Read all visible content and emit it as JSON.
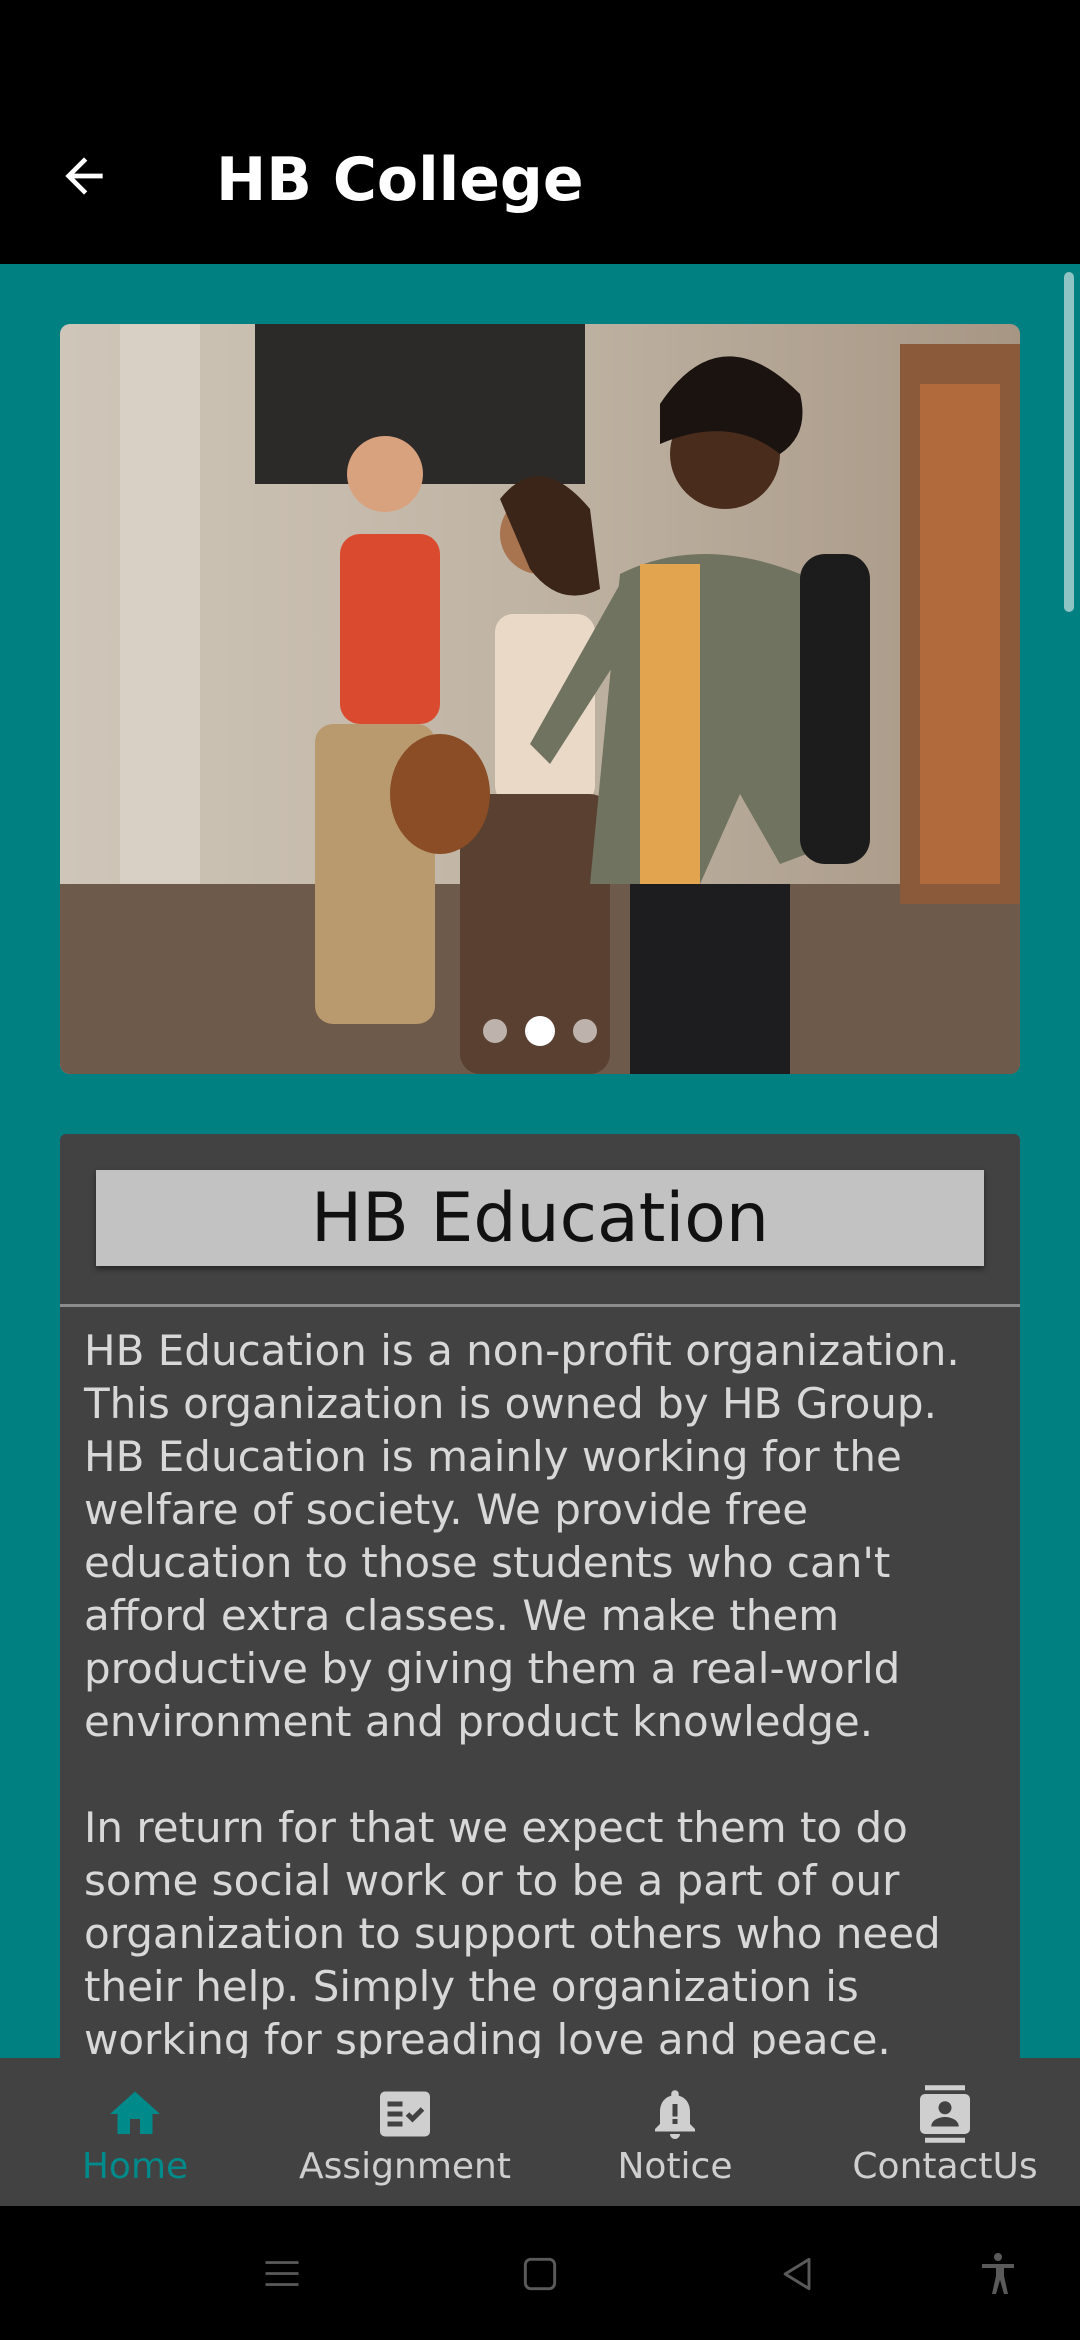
{
  "app_bar": {
    "title": "HB College",
    "back_icon": "arrow-back-icon"
  },
  "carousel": {
    "image_alt": "Three students walking together",
    "slide_count": 3,
    "active_slide": 1
  },
  "info_card": {
    "heading": "HB Education",
    "paragraphs": [
      "HB Education is a non-profit organization. This organization is owned by HB Group. HB Education is mainly working for the welfare of society. We provide free education to those students who can't afford extra classes. We make them productive by giving them a real-world environment and product knowledge.",
      "In return for that we expect them to do some social work or to be a part of our organization to support others who need their help. Simply the organization is working for spreading love and peace."
    ]
  },
  "bottom_nav": {
    "items": [
      {
        "label": "Home",
        "icon": "home-icon",
        "active": true
      },
      {
        "label": "Assignment",
        "icon": "assignment-check-icon",
        "active": false
      },
      {
        "label": "Notice",
        "icon": "bell-alert-icon",
        "active": false
      },
      {
        "label": "ContactUs",
        "icon": "contact-card-icon",
        "active": false
      }
    ]
  },
  "system_nav": {
    "buttons": [
      "menu-icon",
      "home-square-icon",
      "back-triangle-icon",
      "accessibility-icon"
    ]
  },
  "colors": {
    "teal": "#008080",
    "card": "#424242",
    "nav_active": "#008a8a",
    "app_bar": "#000000"
  }
}
